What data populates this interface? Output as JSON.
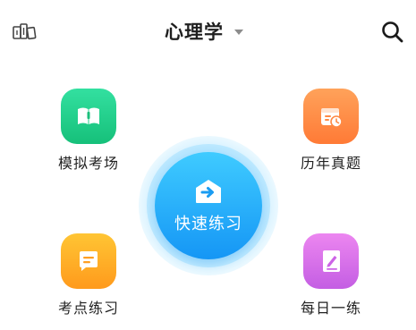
{
  "header": {
    "library_icon": "library-icon",
    "title": "心理学",
    "title_caret_icon": "caret-down-icon",
    "search_icon": "search-icon"
  },
  "features": {
    "mock_exam": {
      "label": "模拟考场",
      "icon": "book-icon",
      "color": "#1fcf88"
    },
    "past_papers": {
      "label": "历年真题",
      "icon": "calendar-clock-icon",
      "color": "#ff8a45"
    },
    "topic_practice": {
      "label": "考点练习",
      "icon": "message-icon",
      "color": "#ffae26"
    },
    "daily_practice": {
      "label": "每日一练",
      "icon": "edit-icon",
      "color": "#d36ee8"
    }
  },
  "quick_practice": {
    "label": "快速练习",
    "icon": "arrow-envelope-icon",
    "color": "#2ab2fb"
  }
}
